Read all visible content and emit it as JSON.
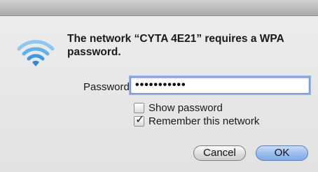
{
  "dialog": {
    "message": "The network “CYTA 4E21” requires a WPA password.",
    "icon": "wifi-icon",
    "accent_color": "#4aa3e8"
  },
  "password": {
    "label": "Password:",
    "value": "•••••••••••"
  },
  "options": {
    "show_password": {
      "label": "Show password",
      "checked": false
    },
    "remember_network": {
      "label": "Remember this network",
      "checked": true,
      "mark": "✓"
    }
  },
  "buttons": {
    "cancel": "Cancel",
    "ok": "OK"
  }
}
